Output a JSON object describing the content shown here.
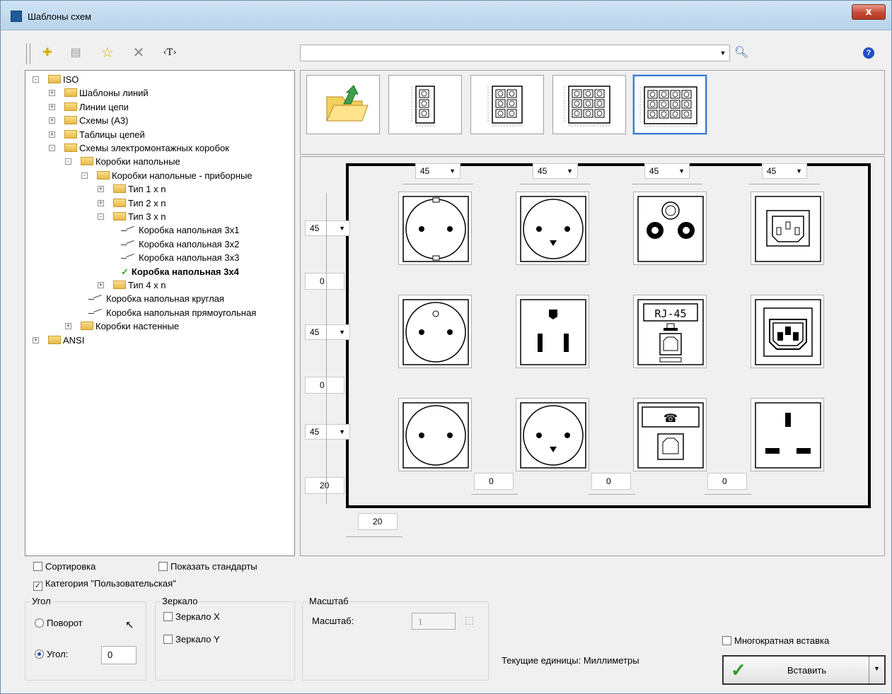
{
  "window": {
    "title": "Шаблоны схем",
    "close_label": "x"
  },
  "toolbar": {
    "text_tool": "‹T›",
    "search_value": ""
  },
  "help_label": "?",
  "tree": [
    {
      "label": "ISO",
      "level": 0,
      "kind": "folder",
      "exp": "-"
    },
    {
      "label": "Шаблоны линий",
      "level": 1,
      "kind": "folder",
      "exp": "+"
    },
    {
      "label": "Линии цепи",
      "level": 1,
      "kind": "folder",
      "exp": "+"
    },
    {
      "label": "Схемы (А3)",
      "level": 1,
      "kind": "folder",
      "exp": "+"
    },
    {
      "label": "Таблицы цепей",
      "level": 1,
      "kind": "folder",
      "exp": "+"
    },
    {
      "label": "Схемы электромонтажных коробок",
      "level": 1,
      "kind": "folder",
      "exp": "-"
    },
    {
      "label": "Коробки напольные",
      "level": 2,
      "kind": "folder",
      "exp": "-"
    },
    {
      "label": "Коробки напольные - приборные",
      "level": 3,
      "kind": "folder",
      "exp": "-"
    },
    {
      "label": "Тип 1 x n",
      "level": 4,
      "kind": "folder",
      "exp": "+"
    },
    {
      "label": "Тип 2 x n",
      "level": 4,
      "kind": "folder",
      "exp": "+"
    },
    {
      "label": "Тип 3 x n",
      "level": 4,
      "kind": "folder",
      "exp": "-"
    },
    {
      "label": "Коробка напольная 3x1",
      "level": 5,
      "kind": "leaf"
    },
    {
      "label": "Коробка напольная 3x2",
      "level": 5,
      "kind": "leaf"
    },
    {
      "label": "Коробка напольная 3x3",
      "level": 5,
      "kind": "leaf"
    },
    {
      "label": "Коробка напольная 3x4",
      "level": 5,
      "kind": "selected"
    },
    {
      "label": "Тип 4 x n",
      "level": 4,
      "kind": "folder",
      "exp": "+"
    },
    {
      "label": "Коробка напольная круглая",
      "level": 3,
      "kind": "leaf"
    },
    {
      "label": "Коробка напольная прямоугольная",
      "level": 3,
      "kind": "leaf"
    },
    {
      "label": "Коробки настенные",
      "level": 2,
      "kind": "folder",
      "exp": "+"
    },
    {
      "label": "ANSI",
      "level": 0,
      "kind": "folder",
      "exp": "+"
    }
  ],
  "canvas": {
    "col_width_values": [
      "45",
      "45",
      "45",
      "45"
    ],
    "row_height_values": [
      "45",
      "45",
      "45"
    ],
    "row_gap_values": [
      "0",
      "0",
      "20"
    ],
    "col_gap_values": [
      "0",
      "0",
      "0"
    ],
    "left_margin_value": "20",
    "rj45_label": "RJ-45"
  },
  "options": {
    "sort": {
      "label": "Сортировка",
      "checked": false
    },
    "show_standards": {
      "label": "Показать стандарты",
      "checked": false
    },
    "custom_category": {
      "label": "Категория \"Пользовательская\"",
      "checked": true
    }
  },
  "angle": {
    "group_label": "Угол",
    "rotation_label": "Поворот",
    "angle_label": "Угол:",
    "angle_value": "0"
  },
  "mirror": {
    "group_label": "Зеркало",
    "x_label": "Зеркало X",
    "y_label": "Зеркало Y"
  },
  "scale": {
    "group_label": "Масштаб",
    "label": "Масштаб:",
    "value": "1"
  },
  "units_text": "Текущие единицы: Миллиметры",
  "multi_insert": {
    "label": "Многократная вставка",
    "checked": false
  },
  "insert_button": {
    "label": "Вставить"
  }
}
